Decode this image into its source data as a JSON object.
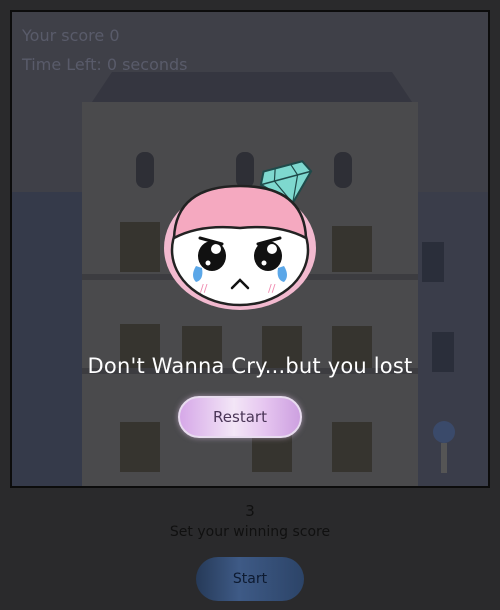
{
  "hud": {
    "score_text": "Your score 0",
    "time_text": "Time Left: 0 seconds"
  },
  "overlay": {
    "message": "Don't Wanna Cry...but you lost",
    "restart_label": "Restart"
  },
  "settings": {
    "winning_score_value": "3",
    "winning_score_caption": "Set your winning score",
    "start_label": "Start"
  }
}
